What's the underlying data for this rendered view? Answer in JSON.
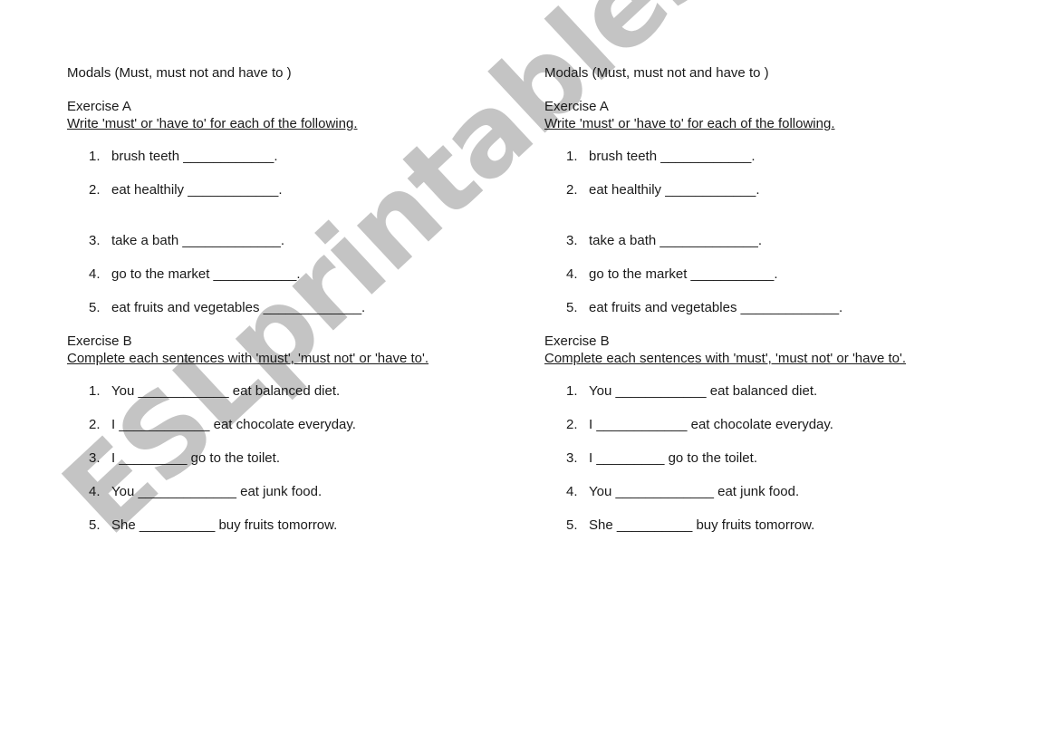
{
  "watermark": "ESLprintables.com",
  "columns": [
    {
      "title": "Modals (Must, must not and have to )",
      "exercise_a": {
        "heading": "Exercise A",
        "instruction": "Write 'must' or 'have to' for each of the following.",
        "items": [
          {
            "num": "1.",
            "text": "brush teeth ____________."
          },
          {
            "num": "2.",
            "text": "eat healthily ____________."
          },
          {
            "num": "3.",
            "text": "take a bath _____________."
          },
          {
            "num": "4.",
            "text": "go to the market ___________."
          },
          {
            "num": "5.",
            "text": "eat fruits and vegetables _____________."
          }
        ]
      },
      "exercise_b": {
        "heading": "Exercise B",
        "instruction": "Complete each sentences with 'must', 'must not' or 'have to'.",
        "items": [
          {
            "num": "1.",
            "text": "You ____________ eat balanced diet."
          },
          {
            "num": "2.",
            "text": "I ____________ eat chocolate everyday."
          },
          {
            "num": "3.",
            "text": "I _________ go to the toilet."
          },
          {
            "num": "4.",
            "text": "You _____________ eat junk food."
          },
          {
            "num": "5.",
            "text": "She __________ buy fruits tomorrow."
          }
        ]
      }
    },
    {
      "title": "Modals (Must, must not and have to )",
      "exercise_a": {
        "heading": "Exercise A",
        "instruction": "Write 'must' or 'have to' for each of the following.",
        "items": [
          {
            "num": "1.",
            "text": "brush teeth ____________."
          },
          {
            "num": "2.",
            "text": "eat healthily ____________."
          },
          {
            "num": "3.",
            "text": "take a bath _____________."
          },
          {
            "num": "4.",
            "text": "go to the market ___________."
          },
          {
            "num": "5.",
            "text": "eat fruits and vegetables _____________."
          }
        ]
      },
      "exercise_b": {
        "heading": "Exercise B",
        "instruction": "Complete each sentences with 'must', 'must not' or 'have to'.",
        "items": [
          {
            "num": "1.",
            "text": "You ____________ eat balanced diet."
          },
          {
            "num": "2.",
            "text": "I ____________ eat chocolate everyday."
          },
          {
            "num": "3.",
            "text": "I _________ go to the toilet."
          },
          {
            "num": "4.",
            "text": "You _____________ eat junk food."
          },
          {
            "num": "5.",
            "text": "She __________ buy fruits tomorrow."
          }
        ]
      }
    }
  ]
}
